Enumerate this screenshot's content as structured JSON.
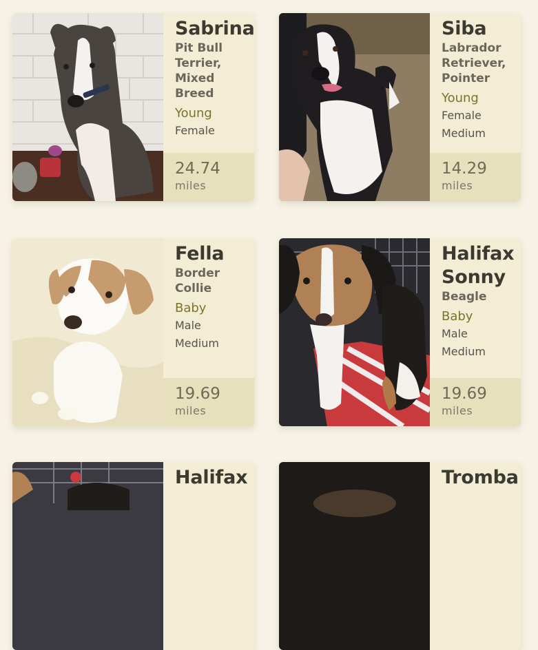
{
  "pets": [
    {
      "name": "Sabrina",
      "breed": "Pit Bull Terrier, Mixed Breed",
      "age": "Young",
      "gender": "Female",
      "size": "",
      "distance": "24.74",
      "distance_unit": "miles"
    },
    {
      "name": "Siba",
      "breed": "Labrador Retriever, Pointer",
      "age": "Young",
      "gender": "Female",
      "size": "Medium",
      "distance": "14.29",
      "distance_unit": "miles"
    },
    {
      "name": "Fella",
      "breed": "Border Collie",
      "age": "Baby",
      "gender": "Male",
      "size": "Medium",
      "distance": "19.69",
      "distance_unit": "miles"
    },
    {
      "name": "Halifax Sonny",
      "breed": "Beagle",
      "age": "Baby",
      "gender": "Male",
      "size": "Medium",
      "distance": "19.69",
      "distance_unit": "miles"
    },
    {
      "name": "Halifax",
      "breed": "",
      "age": "",
      "gender": "",
      "size": "",
      "distance": "",
      "distance_unit": ""
    },
    {
      "name": "Tromba",
      "breed": "",
      "age": "",
      "gender": "",
      "size": "",
      "distance": "",
      "distance_unit": ""
    }
  ],
  "colors": {
    "background": "#f6f3e6",
    "card": "#f3edd5",
    "distance_panel": "#e7e0bd",
    "age_text": "#7d722a"
  }
}
